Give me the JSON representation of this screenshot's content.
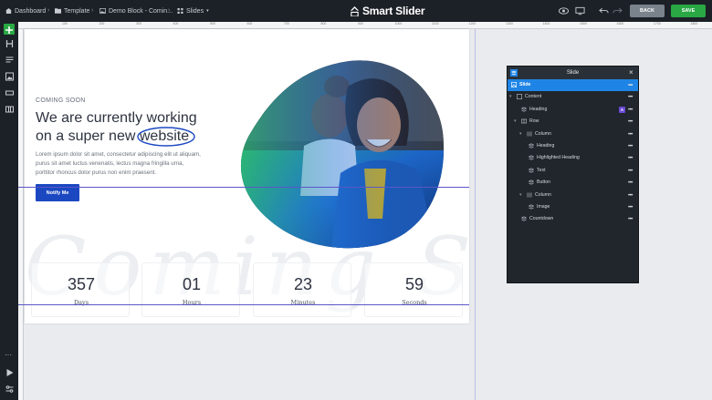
{
  "topbar": {
    "breadcrumbs": [
      "Dashboard",
      "Template",
      "Demo Block - Comin...",
      "Slides"
    ],
    "logo_text": "Smart Slider",
    "back_label": "BACK",
    "save_label": "SAVE"
  },
  "ruler": {
    "ticks": [
      "100",
      "200",
      "300",
      "400",
      "500",
      "600",
      "700",
      "800",
      "900",
      "1000",
      "1100",
      "1200",
      "1300",
      "1400",
      "1500",
      "1600",
      "1700",
      "1800"
    ]
  },
  "slide": {
    "subtitle": "COMING SOON",
    "heading_line1": "We are currently working",
    "heading_line2_prefix": "on a super new ",
    "heading_highlight": "website",
    "body": "Lorem ipsum dolor sit amet, consectetur adipiscing elit ut aliquam, purus sit amet luctus venenatis, lectus magna fringilla urna, porttitor rhoncus dolor purus non enim praesent.",
    "button_label": "Notify Me",
    "bg_text": "Coming Soon",
    "countdown": [
      {
        "value": "357",
        "label": "Days"
      },
      {
        "value": "01",
        "label": "Hours"
      },
      {
        "value": "23",
        "label": "Minutes"
      },
      {
        "value": "59",
        "label": "Seconds"
      }
    ]
  },
  "panel": {
    "title": "Slide",
    "rows": [
      {
        "label": "Slide",
        "selected": true
      },
      {
        "label": "Content"
      },
      {
        "label": "Heading"
      },
      {
        "label": "Row"
      },
      {
        "label": "Column"
      },
      {
        "label": "Heading"
      },
      {
        "label": "Highlighted Heading"
      },
      {
        "label": "Text"
      },
      {
        "label": "Button"
      },
      {
        "label": "Column"
      },
      {
        "label": "Image"
      },
      {
        "label": "Countdown"
      }
    ]
  },
  "colors": {
    "accent": "#1e85e6",
    "save": "#29a844",
    "button": "#1b48c1",
    "guide": "#5b57c7"
  },
  "icons": [
    "plus-icon",
    "heading-icon",
    "text-icon",
    "image-icon",
    "button-icon",
    "layout-icon",
    "more-icon",
    "play-icon",
    "settings-icon",
    "eye-icon",
    "monitor-icon",
    "undo-icon",
    "redo-icon"
  ]
}
